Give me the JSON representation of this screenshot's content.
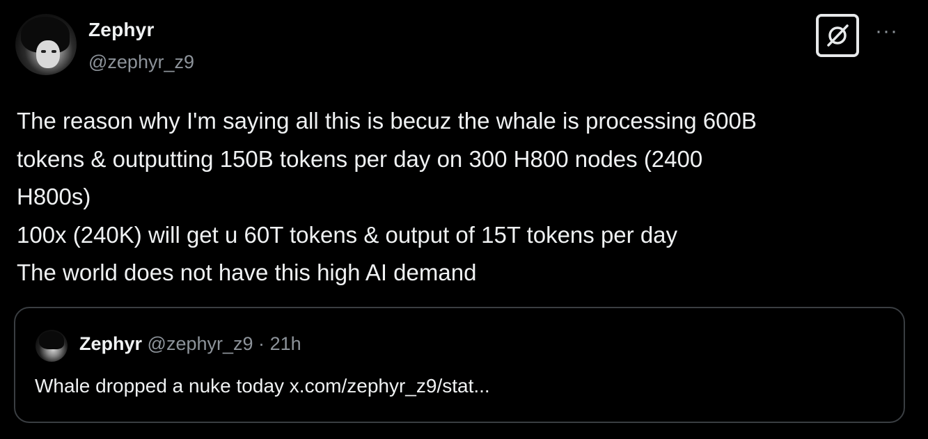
{
  "tweet": {
    "author": {
      "display_name": "Zephyr",
      "handle": "@zephyr_z9"
    },
    "actions": {
      "grok_icon": "grok-icon",
      "more_label": "···"
    },
    "body_lines": [
      "The reason why I'm saying all this is becuz the whale is processing 600B",
      "tokens & outputting 150B tokens per day on 300 H800 nodes (2400",
      "H800s)",
      "100x (240K) will get u 60T tokens & output of 15T tokens per day",
      "The world does not have this high AI demand"
    ],
    "quoted": {
      "display_name": "Zephyr",
      "handle": "@zephyr_z9",
      "separator": "·",
      "time": "21h",
      "text": "Whale dropped a nuke today x.com/zephyr_z9/stat..."
    }
  },
  "colors": {
    "background": "#000000",
    "primary_text": "#eff1f2",
    "secondary_text": "#8d939a",
    "quote_border": "#3a3e42"
  }
}
